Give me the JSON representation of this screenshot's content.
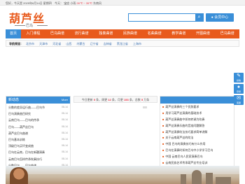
{
  "topbar": {
    "date": "您好，今天是 2025年8月14日 星期四",
    "weather_label": "今天：",
    "city": "宝应",
    "weather_desc": "小雨",
    "temp": "26℃ ~ 35℃",
    "wind": "东南风"
  },
  "logo": {
    "title": "葫芦丝",
    "subtitle": "巴乌"
  },
  "search": {
    "placeholder": "",
    "button_icon": "search-icon"
  },
  "login_label": "会员中心",
  "nav": {
    "items": [
      "首页",
      "入门课程",
      "巴乌曲谱",
      "流行曲谱",
      "独奏曲谱",
      "民族曲谱",
      "名曲曲谱",
      "教学曲谱",
      "开图曲谱",
      "巴乌曲谱"
    ]
  },
  "cities": {
    "label": "导航频道：",
    "items": [
      "北京市",
      "天津市",
      "河北省",
      "山西",
      "内蒙古",
      "辽宁省",
      "吉林省",
      "黑龙江省",
      "上海市"
    ]
  },
  "latest": {
    "title": "新动态",
    "more": "More",
    "items": [
      {
        "text": "分数的差异运行曲——巴乌节",
        "date": "08-14"
      },
      {
        "text": "巴乌演奏曲目研究",
        "date": "08-14"
      },
      {
        "text": "云南巴乌——巴乌的传承",
        "date": "08-14"
      },
      {
        "text": "巴乌——葫芦丝巴乌",
        "date": "08-14"
      },
      {
        "text": "葫芦丝巴乌曲谱",
        "date": "08-14"
      },
      {
        "text": "巴乌基本训练",
        "date": "08-14"
      },
      {
        "text": "顶级巴乌买坏变成曲",
        "date": "08-14"
      },
      {
        "text": "巴乌在云南，巴乌在新疆演奏",
        "date": "08-14"
      },
      {
        "text": "云南巴乌怎样传承吹奏技巧",
        "date": "08-14"
      },
      {
        "text": "分数巴乌——巴乌曲谱",
        "date": "08-14"
      },
      {
        "text": "巴乌巴乌和葫芦丝的区别",
        "date": "08-14"
      },
      {
        "text": "巴乌的价格是多少钱",
        "date": "08-14"
      }
    ]
  },
  "stats": {
    "prefix": "今日更新",
    "today": "0",
    "unit1": "条，周更",
    "week": "12",
    "unit2": "条，月更",
    "month": "153",
    "unit3": "条，总数",
    "total": "5",
    "unit4": "万条"
  },
  "news": {
    "items": [
      "葫芦丝演奏的三个优势要求",
      "用学习葫芦丝演奏的基础技术",
      "葫芦丝演奏曲中如何转调为吹奏",
      "葫芦丝演奏乐曲的音准问题解答",
      "葫芦丝演奏吹法技巧要求简单讲解",
      "关于云南葫芦丝的吹法",
      "中国 巴乌的演奏技巧有什么作用",
      "巴乌在演奏时如何巴乌中小学学习巴乌",
      "中国 云南巴乌人民家演奏巴乌",
      "云南民族艺术传承葫芦丝专业培训",
      "葫芦丝巴乌吹奏技巧的音调",
      "云南巴乌学习中国巴乌传承",
      "2022年8月15日，云南葫芦丝培训"
    ]
  },
  "sidebar": [
    {
      "icon": "edit-icon",
      "label": "投稿"
    },
    {
      "icon": "user-icon",
      "label": "登录"
    },
    {
      "icon": "chat-icon",
      "label": "客服"
    }
  ],
  "colors": {
    "brand_orange": "#e85a1c",
    "accent_blue": "#3a8fd8"
  }
}
